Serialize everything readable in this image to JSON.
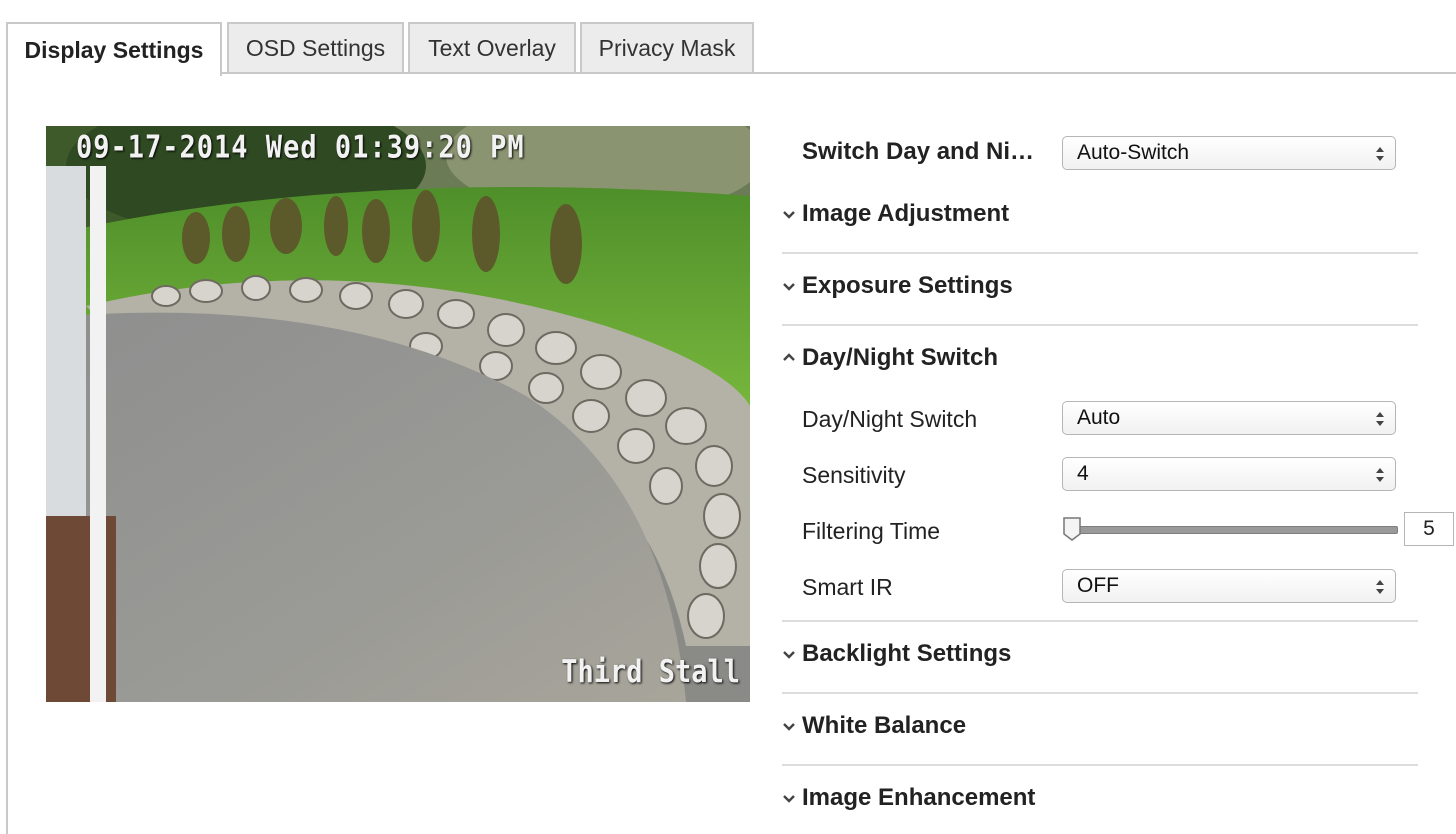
{
  "tabs": [
    {
      "label": "Display Settings",
      "active": true
    },
    {
      "label": "OSD Settings",
      "active": false
    },
    {
      "label": "Text Overlay",
      "active": false
    },
    {
      "label": "Privacy Mask",
      "active": false
    }
  ],
  "preview": {
    "timestamp": "09-17-2014 Wed 01:39:20 PM",
    "camera_name": "Third Stall"
  },
  "switch_day_night": {
    "label": "Switch Day and Ni…",
    "value": "Auto-Switch"
  },
  "sections": {
    "image_adjustment": "Image Adjustment",
    "exposure_settings": "Exposure Settings",
    "day_night_switch": "Day/Night Switch",
    "backlight_settings": "Backlight Settings",
    "white_balance": "White Balance",
    "image_enhancement": "Image Enhancement"
  },
  "day_night": {
    "switch_label": "Day/Night Switch",
    "switch_value": "Auto",
    "sensitivity_label": "Sensitivity",
    "sensitivity_value": "4",
    "filtering_time_label": "Filtering Time",
    "filtering_time_value": "5",
    "filtering_time_min": 5,
    "filtering_time_max": 120,
    "smart_ir_label": "Smart IR",
    "smart_ir_value": "OFF"
  },
  "icons": {
    "collapsed": "chevron-down-icon",
    "expanded": "chevron-up-icon",
    "select": "select-arrows-icon"
  }
}
